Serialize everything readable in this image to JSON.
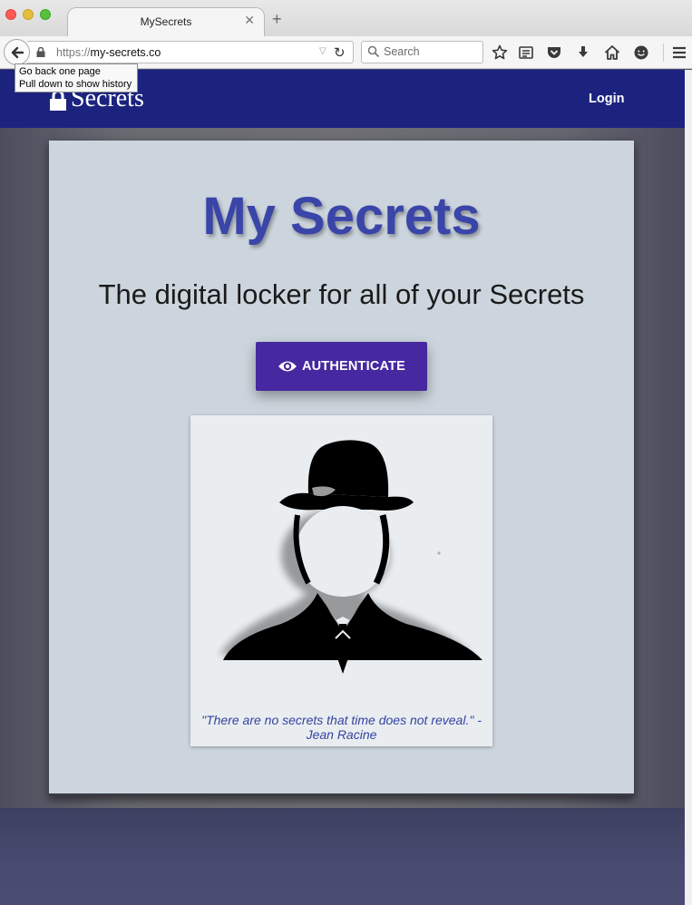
{
  "browser": {
    "tab_title": "MySecrets",
    "url_scheme": "https://",
    "url_host": "my-secrets.co",
    "search_placeholder": "Search",
    "tooltip_line1": "Go back one page",
    "tooltip_line2": "Pull down to show history"
  },
  "header": {
    "brand": "Secrets",
    "login_label": "Login"
  },
  "hero": {
    "title": "My Secrets",
    "subtitle": "The digital locker for all of your Secrets",
    "button_label": "AUTHENTICATE"
  },
  "quote": {
    "text": "\"There are no secrets that time does not reveal.\" - Jean Racine"
  },
  "colors": {
    "header_bg": "#1b237f",
    "title": "#3a45a9",
    "button_bg": "#4628a0",
    "card_bg": "#ccd5dd"
  }
}
